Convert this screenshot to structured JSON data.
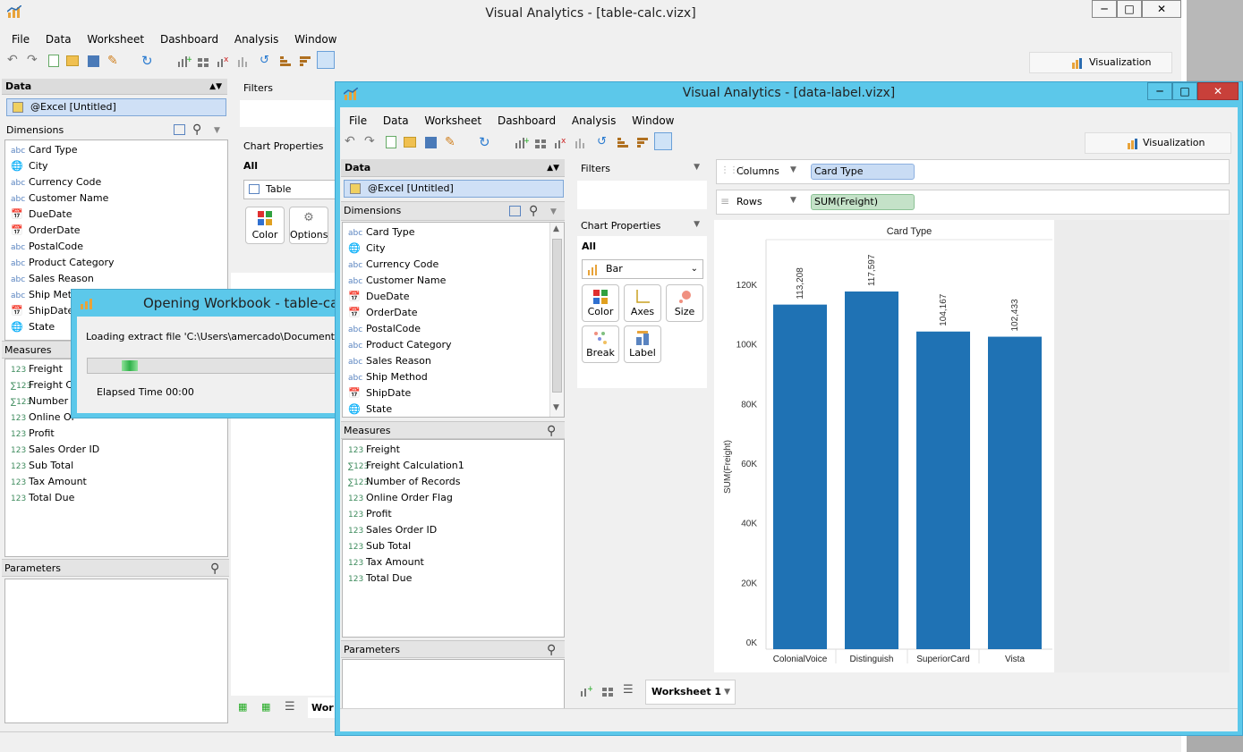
{
  "back_window": {
    "title": "Visual Analytics - [table-calc.vizx]",
    "menu": [
      "File",
      "Data",
      "Worksheet",
      "Dashboard",
      "Analysis",
      "Window"
    ],
    "viz_tab": "Visualization",
    "data_header": "Data",
    "source": "@Excel [Untitled]",
    "dimensions_label": "Dimensions",
    "dimensions": [
      {
        "icon": "abc",
        "label": "Card Type"
      },
      {
        "icon": "globe",
        "label": "City"
      },
      {
        "icon": "abc",
        "label": "Currency Code"
      },
      {
        "icon": "abc",
        "label": "Customer Name"
      },
      {
        "icon": "date",
        "label": "DueDate"
      },
      {
        "icon": "date",
        "label": "OrderDate"
      },
      {
        "icon": "abc",
        "label": "PostalCode"
      },
      {
        "icon": "abc",
        "label": "Product Category"
      },
      {
        "icon": "abc",
        "label": "Sales Reason"
      },
      {
        "icon": "abc",
        "label": "Ship Meth"
      },
      {
        "icon": "date",
        "label": "ShipDate"
      },
      {
        "icon": "globe",
        "label": "State"
      }
    ],
    "measures_label": "Measures",
    "measures": [
      {
        "icon": "123",
        "label": "Freight"
      },
      {
        "icon": "calc",
        "label": "Freight C"
      },
      {
        "icon": "calc",
        "label": "Number o"
      },
      {
        "icon": "123",
        "label": "Online Or"
      },
      {
        "icon": "123",
        "label": "Profit"
      },
      {
        "icon": "123",
        "label": "Sales Order ID"
      },
      {
        "icon": "123",
        "label": "Sub Total"
      },
      {
        "icon": "123",
        "label": "Tax Amount"
      },
      {
        "icon": "123",
        "label": "Total Due"
      }
    ],
    "parameters_label": "Parameters",
    "filters_label": "Filters",
    "chart_properties_label": "Chart Properties",
    "all_label": "All",
    "chart_type": "Table",
    "color_btn": "Color",
    "options_btn": "Options",
    "worksheet_tab": "Wor"
  },
  "dialog": {
    "title": "Opening Workbook - table-calc.",
    "message": "Loading extract file 'C:\\Users\\amercado\\Documents\\Aqua",
    "elapsed": "Elapsed Time 00:00"
  },
  "front_window": {
    "title": "Visual Analytics - [data-label.vizx]",
    "menu": [
      "File",
      "Data",
      "Worksheet",
      "Dashboard",
      "Analysis",
      "Window"
    ],
    "viz_tab": "Visualization",
    "data_header": "Data",
    "source": "@Excel [Untitled]",
    "dimensions_label": "Dimensions",
    "dimensions": [
      {
        "icon": "abc",
        "label": "Card Type"
      },
      {
        "icon": "globe",
        "label": "City"
      },
      {
        "icon": "abc",
        "label": "Currency Code"
      },
      {
        "icon": "abc",
        "label": "Customer Name"
      },
      {
        "icon": "date",
        "label": "DueDate"
      },
      {
        "icon": "date",
        "label": "OrderDate"
      },
      {
        "icon": "abc",
        "label": "PostalCode"
      },
      {
        "icon": "abc",
        "label": "Product Category"
      },
      {
        "icon": "abc",
        "label": "Sales Reason"
      },
      {
        "icon": "abc",
        "label": "Ship Method"
      },
      {
        "icon": "date",
        "label": "ShipDate"
      },
      {
        "icon": "globe",
        "label": "State"
      }
    ],
    "measures_label": "Measures",
    "measures": [
      {
        "icon": "123",
        "label": "Freight"
      },
      {
        "icon": "calc",
        "label": "Freight Calculation1"
      },
      {
        "icon": "calc",
        "label": "Number of Records"
      },
      {
        "icon": "123",
        "label": "Online Order Flag"
      },
      {
        "icon": "123",
        "label": "Profit"
      },
      {
        "icon": "123",
        "label": "Sales Order ID"
      },
      {
        "icon": "123",
        "label": "Sub Total"
      },
      {
        "icon": "123",
        "label": "Tax Amount"
      },
      {
        "icon": "123",
        "label": "Total Due"
      }
    ],
    "parameters_label": "Parameters",
    "filters_label": "Filters",
    "chart_properties_label": "Chart Properties",
    "all_label": "All",
    "chart_type": "Bar",
    "prop_buttons": [
      "Color",
      "Axes",
      "Size",
      "Break",
      "Label"
    ],
    "columns_label": "Columns",
    "columns_pill": "Card Type",
    "rows_label": "Rows",
    "rows_pill": "SUM(Freight)",
    "worksheet_tab": "Worksheet 1"
  },
  "colors": {
    "bar": "#1f72b4",
    "active_title": "#5cc8ea",
    "dim_pill": "#c9dcf4",
    "measure_pill": "#c4e2c8"
  },
  "chart_data": {
    "type": "bar",
    "title": "Card Type",
    "categories": [
      "ColonialVoice",
      "Distinguish",
      "SuperiorCard",
      "Vista"
    ],
    "values": [
      113208,
      117597,
      104167,
      102433
    ],
    "data_labels": [
      "113,208",
      "117,597",
      "104,167",
      "102,433"
    ],
    "ylabel": "SUM(Freight)",
    "xlabel": "",
    "ylim": [
      0,
      120000
    ],
    "yticks": [
      "0K",
      "20K",
      "40K",
      "60K",
      "80K",
      "100K",
      "120K"
    ],
    "grid": false
  }
}
